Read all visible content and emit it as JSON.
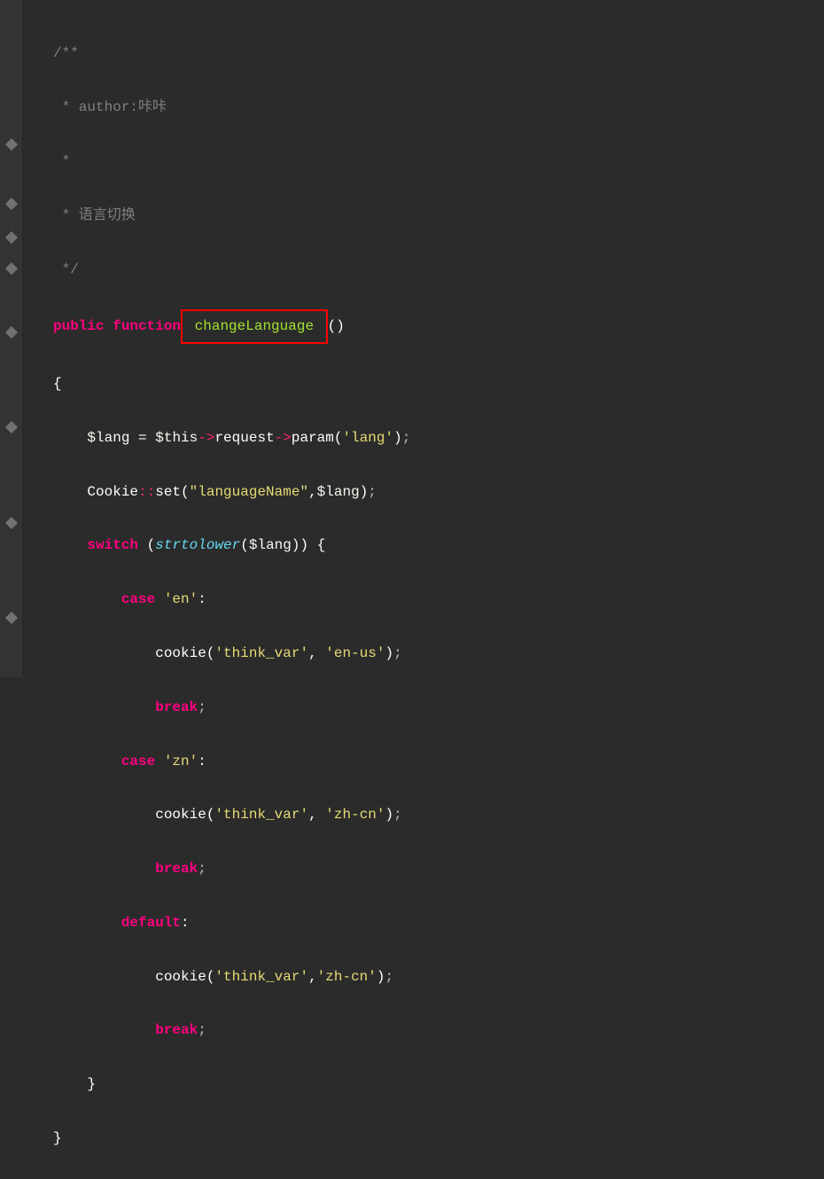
{
  "code": {
    "comment_start": "/**",
    "comment_author": " * author:咔咔",
    "comment_empty": " *",
    "comment_desc": " * 语言切换",
    "comment_end": " */",
    "keyword_public": "public",
    "keyword_function": "function",
    "function_name": " changeLanguage ",
    "parens_empty": "()",
    "brace_open": "{",
    "brace_close": "}",
    "var_lang": "$lang",
    "equals": " = ",
    "var_this": "$this",
    "arrow": "->",
    "prop_request": "request",
    "method_param": "param",
    "str_lang": "'lang'",
    "semicolon": ";",
    "class_cookie": "Cookie",
    "double_colon": "::",
    "method_set": "set",
    "str_languageName": "\"languageName\"",
    "comma": ",",
    "keyword_switch": "switch",
    "func_strtolower": "strtolower",
    "keyword_case": "case",
    "str_en": "'en'",
    "colon": ":",
    "func_cookie": "cookie",
    "str_think_var": "'think_var'",
    "str_en_us": "'en-us'",
    "keyword_break": "break",
    "str_zn": "'zn'",
    "str_zh_cn": "'zh-cn'",
    "keyword_default": "default",
    "paren_open": "(",
    "paren_close": ")",
    "space": " "
  },
  "fold_positions": [
    158,
    225,
    263,
    298,
    370,
    477,
    585,
    692
  ]
}
